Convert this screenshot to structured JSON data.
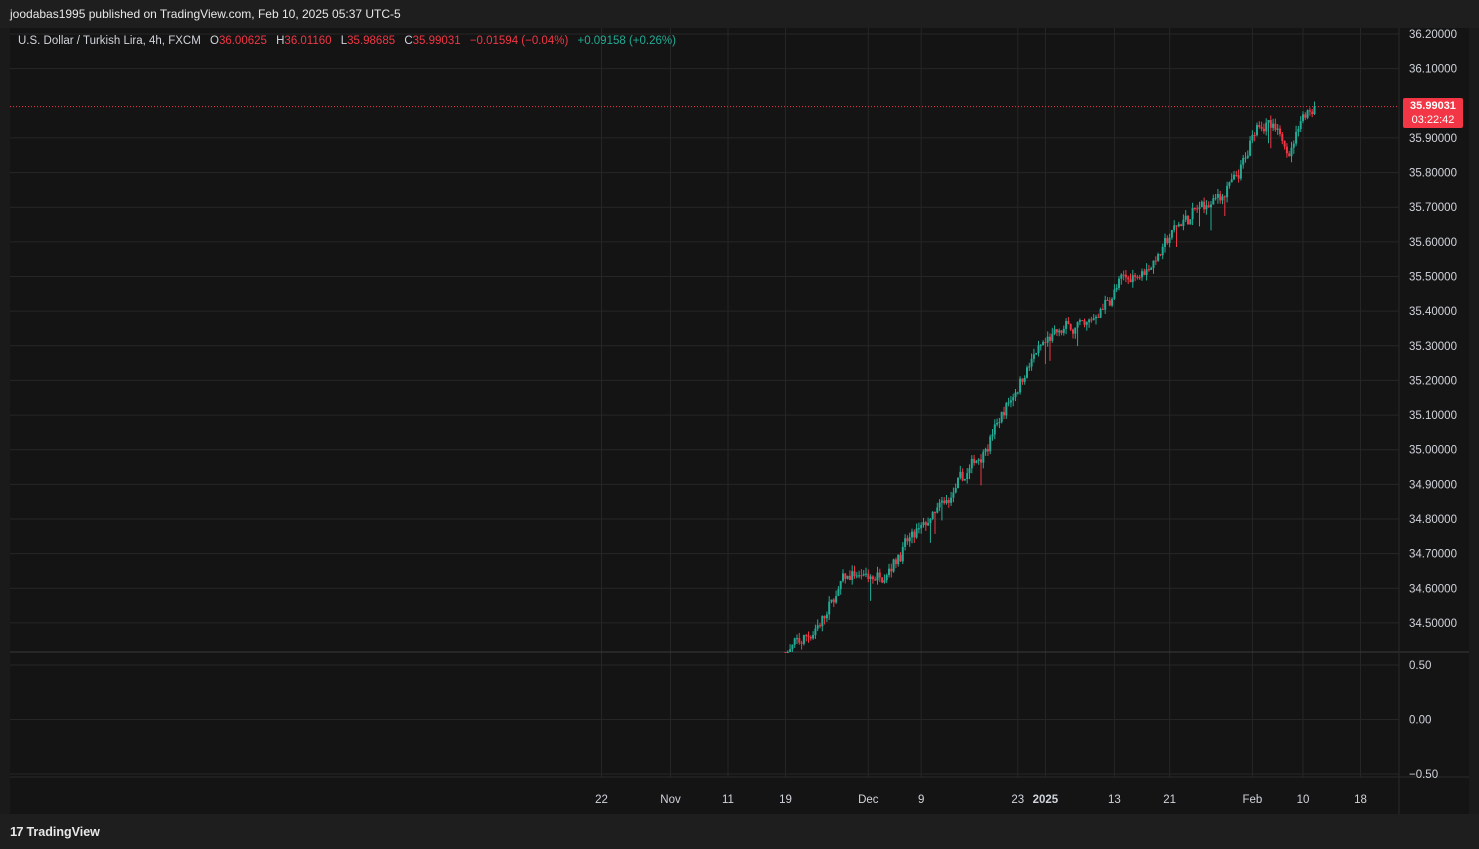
{
  "publish_line": "joodabas1995 published on TradingView.com, Feb 10, 2025 05:37 UTC-5",
  "legend": {
    "symbol": "U.S. Dollar / Turkish Lira, 4h, FXCM",
    "o_label": "O",
    "o_value": "36.00625",
    "h_label": "H",
    "h_value": "36.01160",
    "l_label": "L",
    "l_value": "35.98685",
    "c_label": "C",
    "c_value": "35.99031",
    "change": "−0.01594 (−0.04%)",
    "extra_change": "+0.09158 (+0.26%)"
  },
  "last_price": {
    "price": "35.99031",
    "countdown": "03:22:42"
  },
  "footer": {
    "logo_text": "TradingView",
    "logo_mark": "17"
  },
  "colors": {
    "up": "#22ab94",
    "down": "#f23645",
    "background": "#141414",
    "grid": "#262626",
    "text": "#d1d4dc"
  },
  "chart_data": {
    "type": "candlestick",
    "interval": "4h",
    "price_axis": {
      "ticks": [
        "36.20000",
        "36.10000",
        "35.90000",
        "35.80000",
        "35.70000",
        "35.60000",
        "35.50000",
        "35.40000",
        "35.30000",
        "35.20000",
        "35.10000",
        "35.00000",
        "34.90000",
        "34.80000",
        "34.70000",
        "34.60000",
        "34.50000"
      ],
      "range": [
        34.41,
        36.21
      ]
    },
    "indicator_axis": {
      "ticks": [
        "0.50",
        "0.00",
        "−0.50"
      ],
      "range": [
        -0.6,
        0.62
      ]
    },
    "time_axis": {
      "ticks": [
        {
          "label": "22",
          "i": -265,
          "bold": false
        },
        {
          "label": "Nov",
          "i": -235,
          "bold": false
        },
        {
          "label": "11",
          "i": -210,
          "bold": false
        },
        {
          "label": "19",
          "i": -185,
          "bold": false
        },
        {
          "label": "Dec",
          "i": -149,
          "bold": false
        },
        {
          "label": "9",
          "i": -126,
          "bold": false
        },
        {
          "label": "23",
          "i": -84,
          "bold": false
        },
        {
          "label": "2025",
          "i": -72,
          "bold": true
        },
        {
          "label": "13",
          "i": -42,
          "bold": false
        },
        {
          "label": "21",
          "i": -18,
          "bold": false
        },
        {
          "label": "Feb",
          "i": 18,
          "bold": false
        },
        {
          "label": "10",
          "i": 40,
          "bold": false
        },
        {
          "label": "18",
          "i": 65,
          "bold": false
        }
      ]
    },
    "waypoints": [
      {
        "i": -185,
        "price": 34.41
      },
      {
        "i": -170,
        "price": 34.5
      },
      {
        "i": -160,
        "price": 34.63
      },
      {
        "i": -145,
        "price": 34.63
      },
      {
        "i": -130,
        "price": 34.75
      },
      {
        "i": -115,
        "price": 34.85
      },
      {
        "i": -105,
        "price": 34.95
      },
      {
        "i": -95,
        "price": 35.05
      },
      {
        "i": -80,
        "price": 35.25
      },
      {
        "i": -65,
        "price": 35.35
      },
      {
        "i": -55,
        "price": 35.35
      },
      {
        "i": -40,
        "price": 35.48
      },
      {
        "i": -25,
        "price": 35.55
      },
      {
        "i": -15,
        "price": 35.65
      },
      {
        "i": 0,
        "price": 35.72
      },
      {
        "i": 10,
        "price": 35.77
      },
      {
        "i": 15,
        "price": 35.85
      },
      {
        "i": 20,
        "price": 35.97
      },
      {
        "i": 28,
        "price": 35.9
      },
      {
        "i": 35,
        "price": 35.87
      },
      {
        "i": 38,
        "price": 35.97
      },
      {
        "i": 45,
        "price": 35.99
      }
    ],
    "last_close": 35.99031
  }
}
